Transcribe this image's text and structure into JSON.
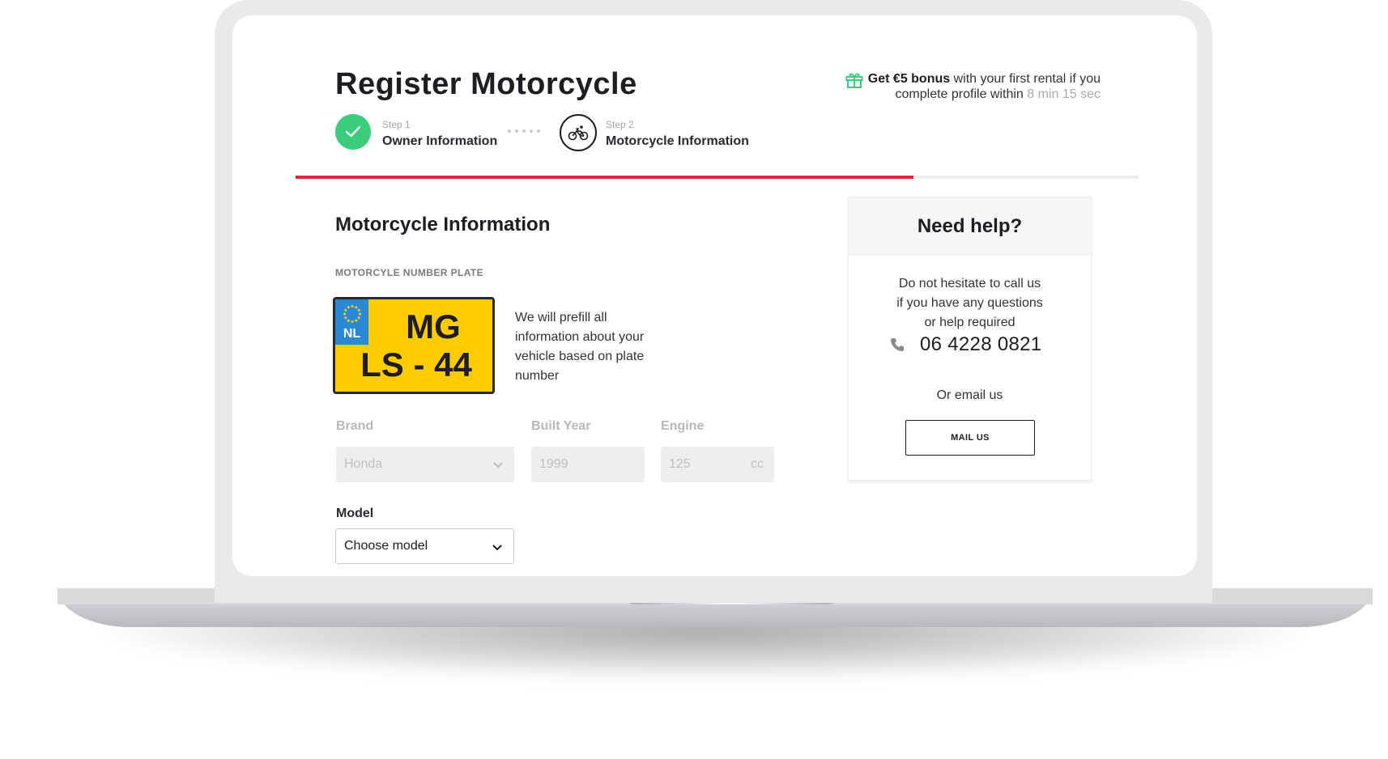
{
  "page": {
    "title": "Register Motorcycle"
  },
  "bonus": {
    "bold": "Get €5 bonus",
    "text1": " with your first rental if you",
    "text2": "complete profile within ",
    "timer": "8 min 15 sec",
    "icon": "gift-icon"
  },
  "steps": [
    {
      "small": "Step 1",
      "label": "Owner Information",
      "status": "completed",
      "icon": "check-icon"
    },
    {
      "small": "Step 2",
      "label": "Motorcycle Information",
      "status": "active",
      "icon": "bicycle-icon"
    }
  ],
  "progress": {
    "fraction": 0.733,
    "color": "#e3243b"
  },
  "form": {
    "section_title": "Motorcycle Information",
    "plate_caption": "MOTORCYLE NUMBER PLATE",
    "plate": {
      "country": "NL",
      "line1": "MG",
      "line2": "LS - 44"
    },
    "plate_note": "We will prefill all information about your vehicle based on plate number",
    "brand": {
      "label": "Brand",
      "value": "Honda"
    },
    "year": {
      "label": "Built Year",
      "value": "1999"
    },
    "engine": {
      "label": "Engine",
      "value": "125",
      "unit": "cc"
    },
    "model": {
      "label": "Model",
      "value": "Choose model"
    }
  },
  "help": {
    "title": "Need help?",
    "line1": "Do not hesitate to call us",
    "line2": "if you have any questions",
    "line3": "or help required",
    "phone": "06 4228 0821",
    "or_email": "Or email us",
    "button": "MAIL US"
  },
  "colors": {
    "accent": "#e3243b",
    "success": "#3ccc7e",
    "plate_yellow": "#ffcc00",
    "eu_blue": "#2a89d6"
  }
}
